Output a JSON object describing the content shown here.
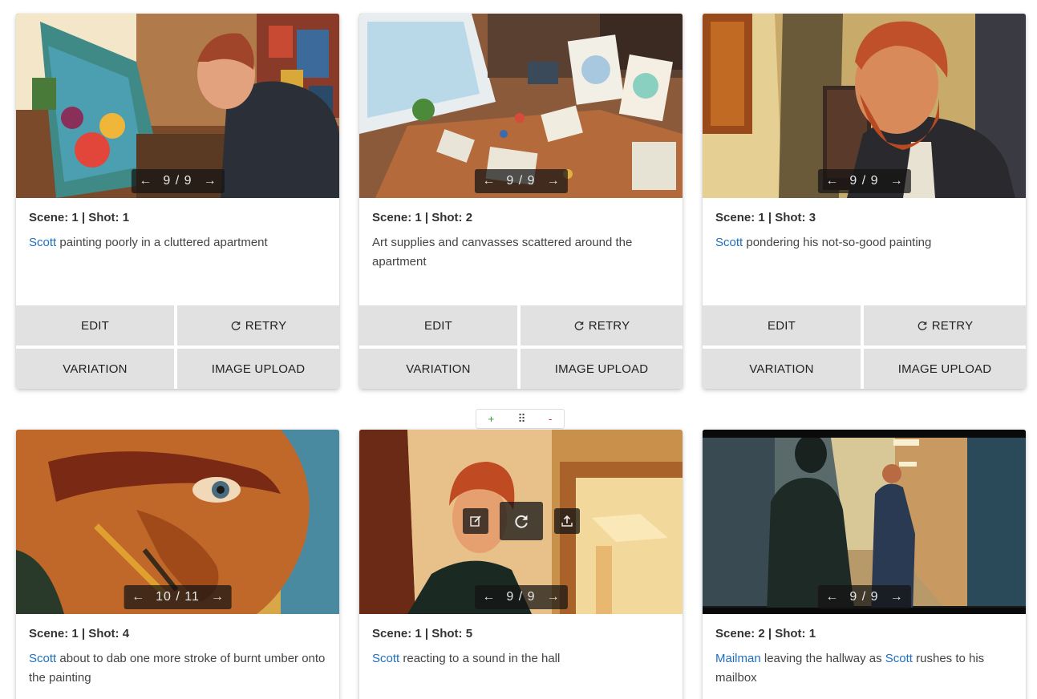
{
  "cards": [
    {
      "title": "Scene: 1 | Shot: 1",
      "character": "Scott",
      "desc_rest": " painting poorly in a cluttered apartment",
      "pager": "9 / 9"
    },
    {
      "title": "Scene: 1 | Shot: 2",
      "desc_plain": "Art supplies and canvasses scattered around the apartment",
      "pager": "9 / 9"
    },
    {
      "title": "Scene: 1 | Shot: 3",
      "character": "Scott",
      "desc_rest": " pondering his not-so-good painting",
      "pager": "9 / 9"
    },
    {
      "title": "Scene: 1 | Shot: 4",
      "character": "Scott",
      "desc_rest": " about to dab one more stroke of burnt umber onto the painting",
      "pager": "10 / 11"
    },
    {
      "title": "Scene: 1 | Shot: 5",
      "character": "Scott",
      "desc_rest": " reacting to a sound in the hall",
      "pager": "9 / 9"
    },
    {
      "title": "Scene: 2 | Shot: 1",
      "character": "Mailman",
      "desc_mid": " leaving the hallway as ",
      "character2": "Scott",
      "desc_rest": " rushes to his mailbox",
      "pager": "9 / 9"
    }
  ],
  "buttons": {
    "edit": "EDIT",
    "retry": "RETRY",
    "variation": "VARIATION",
    "upload": "IMAGE UPLOAD"
  },
  "row_toolbar": {
    "add": "+",
    "drag": "⠿",
    "remove": "-"
  },
  "pager_arrows": {
    "prev": "←",
    "next": "→"
  },
  "icons": {
    "prev": "arrow-left-icon",
    "next": "arrow-right-icon",
    "retry": "refresh-icon",
    "edit": "edit-icon",
    "upload": "upload-icon",
    "drag": "drag-handle-icon"
  },
  "colors": {
    "character_link": "#1f6fc0",
    "button_bg": "#e1e1e1",
    "add": "#2a9d2a",
    "remove": "#cc3333"
  }
}
